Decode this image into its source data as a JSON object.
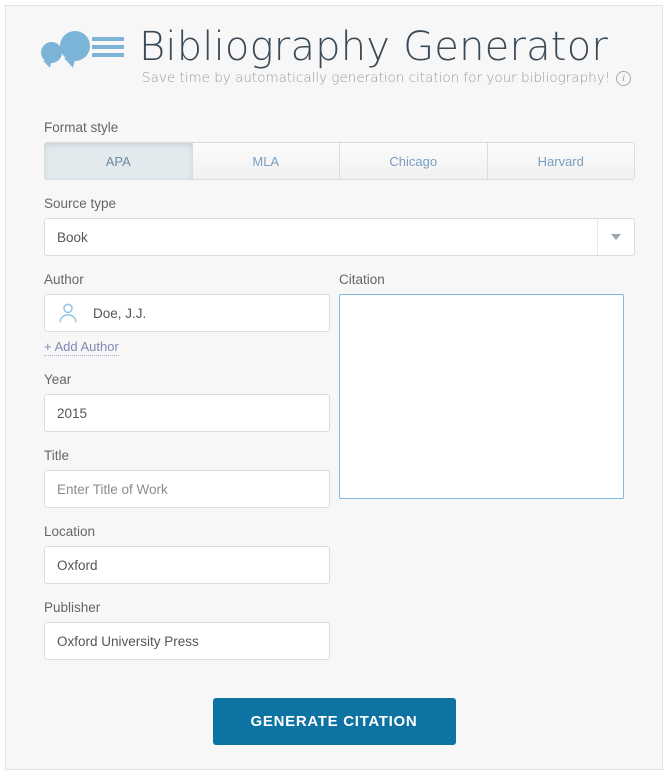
{
  "app": {
    "title": "Bibliography Generator",
    "subtitle": "Save time by automatically generation citation for your bibliography!",
    "info_icon": "info-circle-icon",
    "logo_icon": "speech-bubbles-lines-logo",
    "accent_color": "#7cb4d8",
    "button_color": "#0d73a3",
    "citation_border_color": "#7dbbe3",
    "link_color": "#8189b5"
  },
  "format_style": {
    "label": "Format style",
    "tabs": [
      {
        "label": "APA",
        "active": true
      },
      {
        "label": "MLA",
        "active": false
      },
      {
        "label": "Chicago",
        "active": false
      },
      {
        "label": "Harvard",
        "active": false
      }
    ]
  },
  "source_type": {
    "label": "Source type",
    "value": "Book",
    "arrow_icon": "chevron-down-icon"
  },
  "author": {
    "label": "Author",
    "value": "Doe, J.J.",
    "placeholder": "",
    "icon": "person-icon",
    "add_link": "+ Add Author"
  },
  "year": {
    "label": "Year",
    "value": "2015",
    "placeholder": ""
  },
  "title_field": {
    "label": "Title",
    "value": "",
    "placeholder": "Enter Title of Work"
  },
  "location": {
    "label": "Location",
    "value": "Oxford",
    "placeholder": ""
  },
  "publisher": {
    "label": "Publisher",
    "value": "Oxford University Press",
    "placeholder": ""
  },
  "citation": {
    "label": "Citation",
    "value": "",
    "placeholder": ""
  },
  "actions": {
    "generate_label": "GENERATE CITATION"
  }
}
